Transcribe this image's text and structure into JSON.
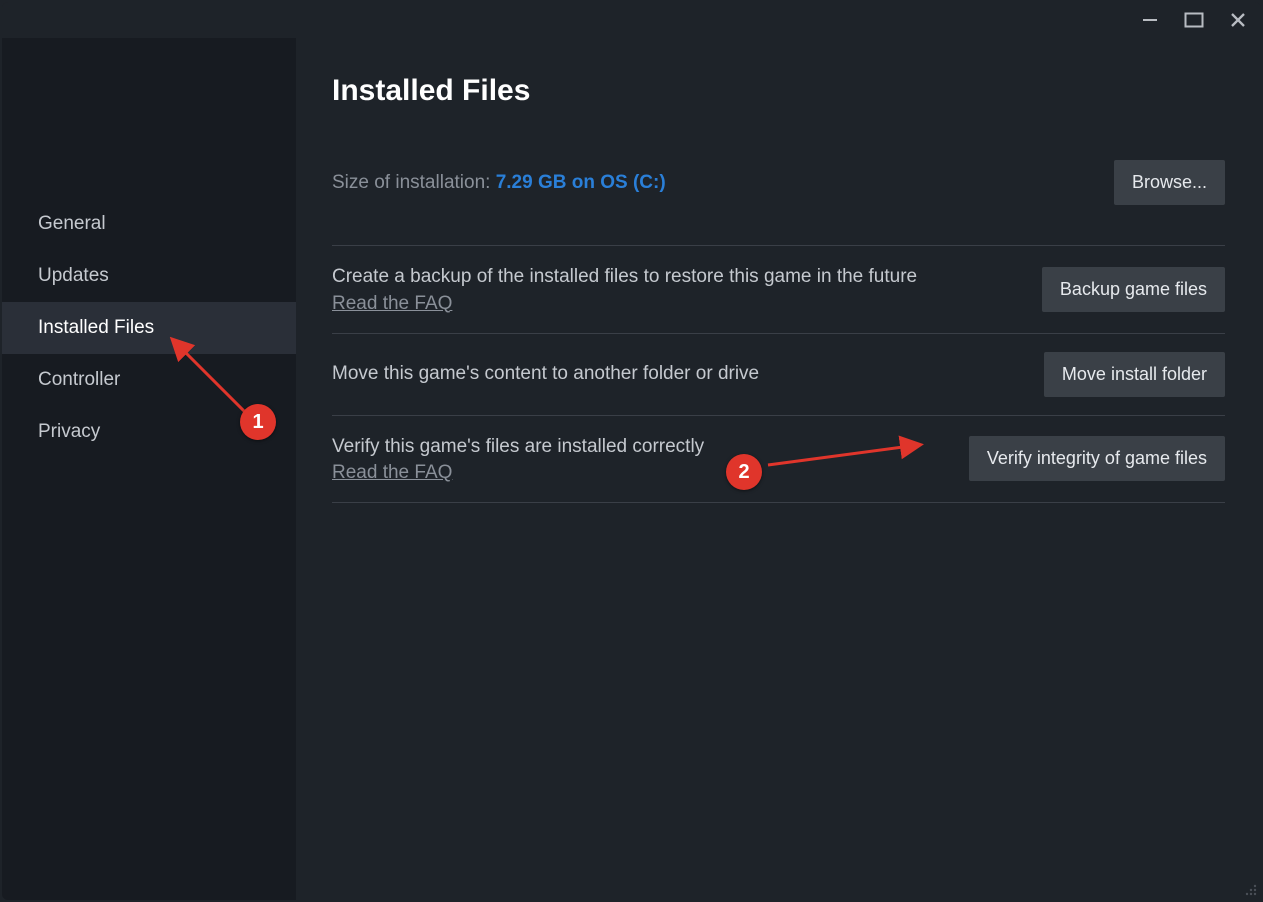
{
  "sidebar": {
    "items": [
      {
        "label": "General"
      },
      {
        "label": "Updates"
      },
      {
        "label": "Installed Files"
      },
      {
        "label": "Controller"
      },
      {
        "label": "Privacy"
      }
    ]
  },
  "main": {
    "title": "Installed Files",
    "size_label": "Size of installation: ",
    "size_value": "7.29 GB on OS (C:)",
    "browse_button": "Browse...",
    "sections": [
      {
        "desc": "Create a backup of the installed files to restore this game in the future",
        "faq": "Read the FAQ",
        "button": "Backup game files"
      },
      {
        "desc": "Move this game's content to another folder or drive",
        "faq": "",
        "button": "Move install folder"
      },
      {
        "desc": "Verify this game's files are installed correctly",
        "faq": "Read the FAQ",
        "button": "Verify integrity of game files"
      }
    ]
  },
  "annotations": {
    "badge1": "1",
    "badge2": "2"
  }
}
